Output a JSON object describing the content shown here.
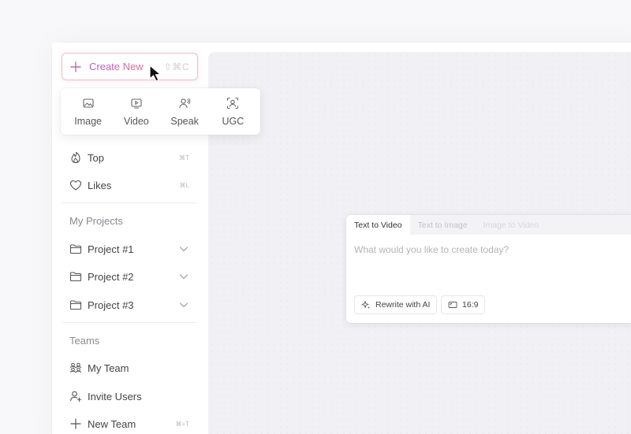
{
  "create_button": {
    "label": "Create New",
    "shortcut": "⇧⌘C"
  },
  "create_menu": {
    "items": [
      {
        "label": "Image",
        "icon": "image-icon"
      },
      {
        "label": "Video",
        "icon": "video-icon"
      },
      {
        "label": "Speak",
        "icon": "speak-icon"
      },
      {
        "label": "UGC",
        "icon": "ugc-icon"
      }
    ]
  },
  "sidebar": {
    "top": {
      "label": "Top",
      "shortcut": "⌘T",
      "icon": "flame-icon"
    },
    "likes": {
      "label": "Likes",
      "shortcut": "⌘L",
      "icon": "heart-icon"
    },
    "projects_title": "My Projects",
    "projects": [
      {
        "label": "Project #1",
        "icon": "folder-icon"
      },
      {
        "label": "Project #2",
        "icon": "folder-icon"
      },
      {
        "label": "Project #3",
        "icon": "folder-icon"
      }
    ],
    "teams_title": "Teams",
    "my_team": {
      "label": "My Team",
      "icon": "team-icon"
    },
    "invite_users": {
      "label": "Invite Users",
      "icon": "user-plus-icon"
    },
    "new_team": {
      "label": "New Team",
      "shortcut": "⌘+T",
      "icon": "plus-icon"
    }
  },
  "prompt_card": {
    "tabs": [
      {
        "label": "Text to Video",
        "active": true
      },
      {
        "label": "Text to Image",
        "active": false
      },
      {
        "label": "Image to Video",
        "active": false
      }
    ],
    "placeholder": "What would you like to create today?",
    "rewrite_label": "Rewrite with AI",
    "aspect_label": "16:9"
  },
  "colors": {
    "accent_start": "#b75cd0",
    "accent_end": "#e46a8f",
    "main_bg": "#f1f1f5"
  }
}
